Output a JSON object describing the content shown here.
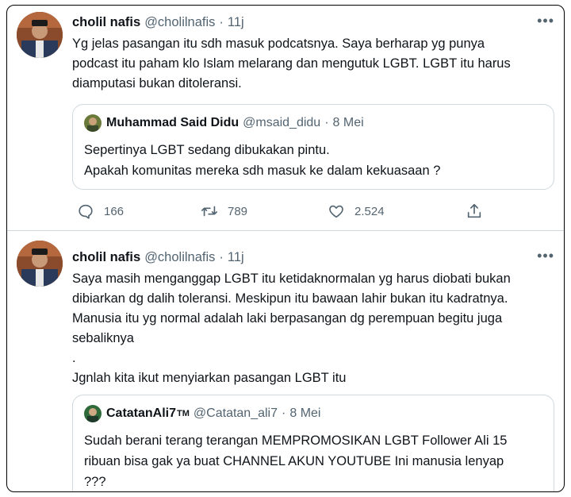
{
  "tweets": [
    {
      "author_name": "cholil nafis",
      "author_handle": "@cholilnafis",
      "separator": "·",
      "time": "11j",
      "more": "•••",
      "text_lines": [
        "Yg jelas pasangan itu sdh masuk podcatsnya. Saya berharap yg punya",
        "podcast itu paham klo Islam melarang dan mengutuk LGBT. LGBT itu harus",
        "diamputasi bukan ditoleransi."
      ],
      "quote": {
        "author_name": "Muhammad Said Didu",
        "author_handle": "@msaid_didu",
        "separator": "·",
        "time": "8 Mei",
        "text_lines": [
          "Sepertinya LGBT sedang dibukakan pintu.",
          "Apakah komunitas mereka sdh masuk ke dalam kekuasaan ?"
        ]
      },
      "actions": {
        "replies": "166",
        "retweets": "789",
        "likes": "2.524"
      }
    },
    {
      "author_name": "cholil nafis",
      "author_handle": "@cholilnafis",
      "separator": "·",
      "time": "11j",
      "more": "•••",
      "text_lines": [
        "Saya masih menganggap LGBT itu ketidaknormalan yg harus diobati bukan",
        "dibiarkan dg dalih toleransi. Meskipun itu bawaan lahir bukan itu kadratnya.",
        "Manusia itu yg normal adalah laki berpasangan dg perempuan begitu juga",
        "sebaliknya",
        ".",
        "Jgnlah kita ikut menyiarkan pasangan LGBT itu"
      ],
      "quote": {
        "author_name": "CatatanAli7",
        "author_suffix": "TM",
        "author_handle": "@Catatan_ali7",
        "separator": "·",
        "time": "8 Mei",
        "text_lines": [
          "Sudah berani terang terangan MEMPROMOSIKAN LGBT Follower Ali 15",
          "ribuan bisa gak ya buat CHANNEL AKUN YOUTUBE Ini manusia lenyap",
          "???"
        ]
      }
    }
  ],
  "icons": {
    "reply": "reply-icon",
    "retweet": "retweet-icon",
    "like": "heart-icon",
    "share": "share-icon",
    "more": "more-icon"
  },
  "colors": {
    "secondary_text": "#536471",
    "border": "#cfd9de",
    "primary_text": "#0f1419"
  }
}
